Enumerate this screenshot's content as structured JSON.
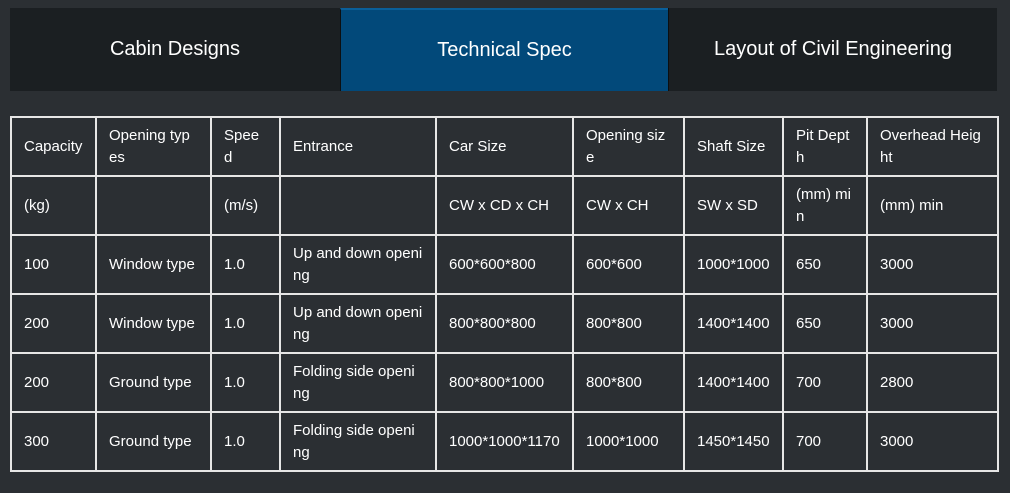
{
  "tabs": [
    {
      "label": "Cabin Designs",
      "active": false
    },
    {
      "label": "Technical Spec",
      "active": true
    },
    {
      "label": "Layout of Civil Engineering",
      "active": false
    }
  ],
  "table": {
    "header_row1": [
      "Capacity",
      "Opening types",
      "Speed",
      "Entrance",
      "Car Size",
      "Opening size",
      "Shaft Size",
      "Pit Depth",
      "Overhead Height"
    ],
    "header_row2": [
      "(kg)",
      "",
      "(m/s)",
      "",
      "CW x CD x CH",
      "CW x CH",
      "SW x SD",
      "(mm) min",
      "(mm) min"
    ],
    "rows": [
      [
        "100",
        "Window type",
        "1.0",
        "Up and down opening",
        "600*600*800",
        "600*600",
        "1000*1000",
        "650",
        "3000"
      ],
      [
        "200",
        "Window type",
        "1.0",
        "Up and down opening",
        "800*800*800",
        "800*800",
        "1400*1400",
        "650",
        "3000"
      ],
      [
        "200",
        "Ground type",
        "1.0",
        "Folding side opening",
        "800*800*1000",
        "800*800",
        "1400*1400",
        "700",
        "2800"
      ],
      [
        "300",
        "Ground type",
        "1.0",
        "Folding side opening",
        "1000*1000*1170",
        "1000*1000",
        "1450*1450",
        "700",
        "3000"
      ]
    ]
  }
}
